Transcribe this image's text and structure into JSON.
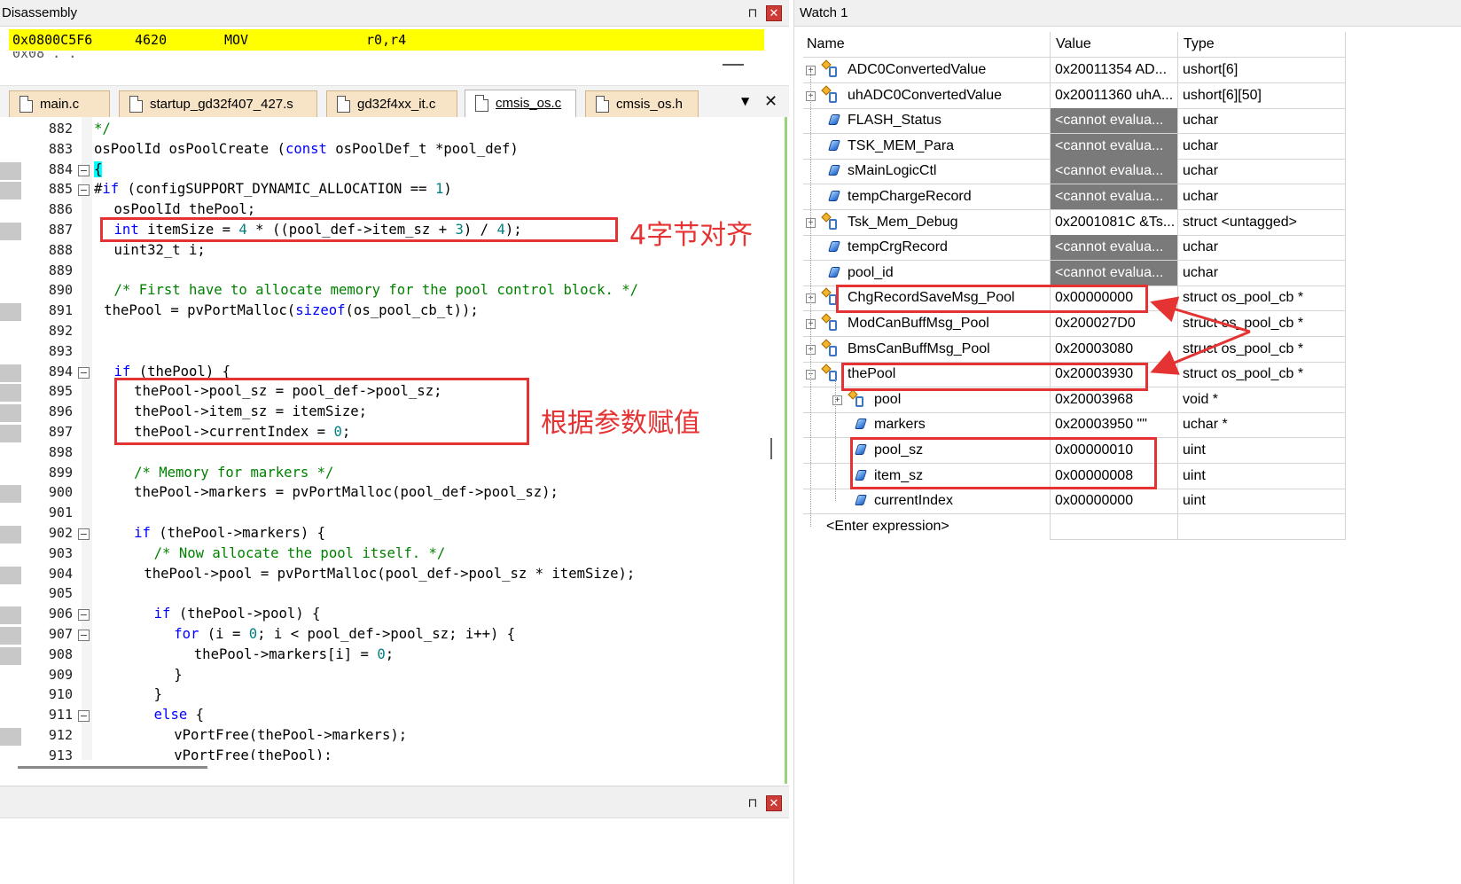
{
  "disassembly": {
    "title": "Disassembly",
    "line": {
      "addr": "0x0800C5F6",
      "opcode": "4620",
      "mnemonic": "MOV",
      "operands": "r0,r4"
    },
    "partial_line": "0x08  . ."
  },
  "tabs": [
    {
      "label": "main.c",
      "active": false
    },
    {
      "label": "startup_gd32f407_427.s",
      "active": false
    },
    {
      "label": "gd32f4xx_it.c",
      "active": false
    },
    {
      "label": "cmsis_os.c",
      "active": true
    },
    {
      "label": "cmsis_os.h",
      "active": false
    }
  ],
  "code_lines": [
    {
      "num": "882",
      "text": "*/",
      "indent": 0
    },
    {
      "num": "883",
      "text": "osPoolId osPoolCreate (const osPoolDef_t *pool_def)",
      "indent": 0
    },
    {
      "num": "884",
      "text": "{",
      "indent": 0
    },
    {
      "num": "885",
      "text": "#if (configSUPPORT_DYNAMIC_ALLOCATION == 1)",
      "indent": 0
    },
    {
      "num": "886",
      "text": "osPoolId thePool;",
      "indent": 2
    },
    {
      "num": "887",
      "text": "int itemSize = 4 * ((pool_def->item_sz + 3) / 4);",
      "indent": 2
    },
    {
      "num": "888",
      "text": "uint32_t i;",
      "indent": 2
    },
    {
      "num": "889",
      "text": "",
      "indent": 0
    },
    {
      "num": "890",
      "text": "/* First have to allocate memory for the pool control block. */",
      "indent": 2
    },
    {
      "num": "891",
      "text": "thePool = pvPortMalloc(sizeof(os_pool_cb_t));",
      "indent": 1
    },
    {
      "num": "892",
      "text": "",
      "indent": 0
    },
    {
      "num": "893",
      "text": "",
      "indent": 0
    },
    {
      "num": "894",
      "text": "if (thePool) {",
      "indent": 2
    },
    {
      "num": "895",
      "text": "thePool->pool_sz = pool_def->pool_sz;",
      "indent": 4
    },
    {
      "num": "896",
      "text": "thePool->item_sz = itemSize;",
      "indent": 4
    },
    {
      "num": "897",
      "text": "thePool->currentIndex = 0;",
      "indent": 4
    },
    {
      "num": "898",
      "text": "",
      "indent": 0
    },
    {
      "num": "899",
      "text": "/* Memory for markers */",
      "indent": 4
    },
    {
      "num": "900",
      "text": "thePool->markers = pvPortMalloc(pool_def->pool_sz);",
      "indent": 4
    },
    {
      "num": "901",
      "text": "",
      "indent": 0
    },
    {
      "num": "902",
      "text": "if (thePool->markers) {",
      "indent": 4
    },
    {
      "num": "903",
      "text": "/* Now allocate the pool itself. */",
      "indent": 6
    },
    {
      "num": "904",
      "text": "thePool->pool = pvPortMalloc(pool_def->pool_sz * itemSize);",
      "indent": 5
    },
    {
      "num": "905",
      "text": "",
      "indent": 0
    },
    {
      "num": "906",
      "text": "if (thePool->pool) {",
      "indent": 6
    },
    {
      "num": "907",
      "text": "for (i = 0; i < pool_def->pool_sz; i++) {",
      "indent": 8
    },
    {
      "num": "908",
      "text": "thePool->markers[i] = 0;",
      "indent": 10
    },
    {
      "num": "909",
      "text": "}",
      "indent": 8
    },
    {
      "num": "910",
      "text": "}",
      "indent": 6
    },
    {
      "num": "911",
      "text": "else {",
      "indent": 6
    },
    {
      "num": "912",
      "text": "vPortFree(thePool->markers);",
      "indent": 8
    },
    {
      "num": "913",
      "text": "vPortFree(thePool);",
      "indent": 8
    }
  ],
  "watch": {
    "title": "Watch 1",
    "columns": [
      "Name",
      "Value",
      "Type"
    ],
    "rows": [
      {
        "name": "ADC0ConvertedValue",
        "value": "0x20011354 AD...",
        "type": "ushort[6]",
        "kind": "struct",
        "expander": "+",
        "level": 0
      },
      {
        "name": "uhADC0ConvertedValue",
        "value": "0x20011360 uhA...",
        "type": "ushort[6][50]",
        "kind": "struct",
        "expander": "+",
        "level": 0
      },
      {
        "name": "FLASH_Status",
        "value": "<cannot evalua...",
        "type": "uchar",
        "kind": "var",
        "expander": "",
        "level": 0,
        "error": true
      },
      {
        "name": "TSK_MEM_Para",
        "value": "<cannot evalua...",
        "type": "uchar",
        "kind": "var",
        "expander": "",
        "level": 0,
        "error": true
      },
      {
        "name": "sMainLogicCtl",
        "value": "<cannot evalua...",
        "type": "uchar",
        "kind": "var",
        "expander": "",
        "level": 0,
        "error": true
      },
      {
        "name": "tempChargeRecord",
        "value": "<cannot evalua...",
        "type": "uchar",
        "kind": "var",
        "expander": "",
        "level": 0,
        "error": true
      },
      {
        "name": "Tsk_Mem_Debug",
        "value": "0x2001081C &Ts...",
        "type": "struct <untagged>",
        "kind": "struct",
        "expander": "+",
        "level": 0
      },
      {
        "name": "tempCrgRecord",
        "value": "<cannot evalua...",
        "type": "uchar",
        "kind": "var",
        "expander": "",
        "level": 0,
        "error": true
      },
      {
        "name": "pool_id",
        "value": "<cannot evalua...",
        "type": "uchar",
        "kind": "var",
        "expander": "",
        "level": 0,
        "error": true
      },
      {
        "name": "ChgRecordSaveMsg_Pool",
        "value": "0x00000000",
        "type": "struct os_pool_cb *",
        "kind": "struct",
        "expander": "+",
        "level": 0
      },
      {
        "name": "ModCanBuffMsg_Pool",
        "value": "0x200027D0",
        "type": "struct os_pool_cb *",
        "kind": "struct",
        "expander": "+",
        "level": 0
      },
      {
        "name": "BmsCanBuffMsg_Pool",
        "value": "0x20003080",
        "type": "struct os_pool_cb *",
        "kind": "struct",
        "expander": "+",
        "level": 0
      },
      {
        "name": "thePool",
        "value": "0x20003930",
        "type": "struct os_pool_cb *",
        "kind": "struct",
        "expander": "−",
        "level": 0
      },
      {
        "name": "pool",
        "value": "0x20003968",
        "type": "void *",
        "kind": "struct",
        "expander": "+",
        "level": 1
      },
      {
        "name": "markers",
        "value": "0x20003950 \"\"",
        "type": "uchar *",
        "kind": "var",
        "expander": "",
        "level": 1
      },
      {
        "name": "pool_sz",
        "value": "0x00000010",
        "type": "uint",
        "kind": "var",
        "expander": "",
        "level": 1
      },
      {
        "name": "item_sz",
        "value": "0x00000008",
        "type": "uint",
        "kind": "var",
        "expander": "",
        "level": 1
      },
      {
        "name": "currentIndex",
        "value": "0x00000000",
        "type": "uint",
        "kind": "var",
        "expander": "",
        "level": 1
      }
    ],
    "enter_expression": "<Enter expression>"
  },
  "annotations": {
    "align_note": "4字节对齐",
    "assign_note": "根据参数赋值"
  },
  "colors": {
    "highlight": "#ffff00",
    "annotation_red": "#e53232",
    "keyword_blue": "#0000ff",
    "comment_green": "#008000",
    "number_teal": "#008080",
    "tab_inactive": "#f7e3c6",
    "error_cell": "#7a7a7a"
  }
}
